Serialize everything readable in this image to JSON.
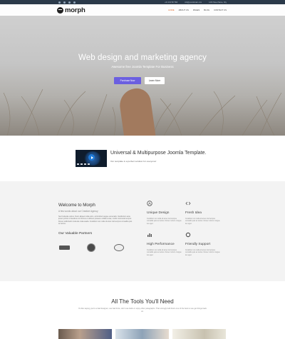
{
  "topbar": {
    "contact": [
      "+01 234 567 890",
      "info@yourdomain.com",
      "1234 Street Name, City"
    ]
  },
  "header": {
    "logo_text": "morph",
    "nav": [
      {
        "label": "HOME",
        "active": true
      },
      {
        "label": "ABOUT US",
        "active": false
      },
      {
        "label": "PAGES",
        "active": false
      },
      {
        "label": "BLOG",
        "active": false
      },
      {
        "label": "CONTACT US",
        "active": false
      }
    ]
  },
  "hero": {
    "title": "Web design and marketing agency",
    "subtitle": "Awesome free Joomla Template For Business",
    "primary_button": "Purchase Now",
    "secondary_button": "Learn More"
  },
  "video_section": {
    "title": "Universal & Multipurpose Joomla Template.",
    "subtitle": "Our template is a perfect solution for everyone!"
  },
  "welcome": {
    "title": "Welcome to Morph",
    "subtitle": "A few words about our Creative Agency",
    "text": "Sed molestie varius. Nunc aliquet nulla enim, at tincidunt augue venenatis. Vestibulum ante ipsum primis in faucibus orci luctus et ultrices posuere cubilia curae; morbi commodo tempor. Donec sollicitudin molestie malesuada. Curabitur non nulla sit amet nisl tempus convallis quis ac lectus.",
    "partners_title": "Our Valuable Partners"
  },
  "features": [
    {
      "icon": "compass-icon",
      "title": "Unique Design",
      "text": "Curabitur non nulla sit amet nisl tempus convallis quis ac lectus. Donec rutrum congue leo eget."
    },
    {
      "icon": "code-icon",
      "title": "Fresh Idea",
      "text": "Curabitur non nulla sit amet nisl tempus convallis quis ac lectus. Donec rutrum congue leo eget."
    },
    {
      "icon": "bar-chart-icon",
      "title": "High Performance",
      "text": "Curabitur non nulla sit amet nisl tempus convallis quis ac lectus. Donec rutrum congue leo eget."
    },
    {
      "icon": "whatsapp-icon",
      "title": "Friendly Support",
      "text": "Curabitur non nulla sit amet nisl tempus convallis quis ac lectus. Donec rutrum congue leo eget."
    }
  ],
  "tools": {
    "title": "All The Tools You'll Need",
    "subtitle": "It's like saying you're a bad designer, use bad fonts, don't use Helix or enjoy other paragraphs. That strongly built that's one of the best to use get things back on."
  },
  "colors": {
    "accent": "#e36b2d",
    "primary_button": "#6b5fe0",
    "topbar": "#2b3a4a"
  }
}
